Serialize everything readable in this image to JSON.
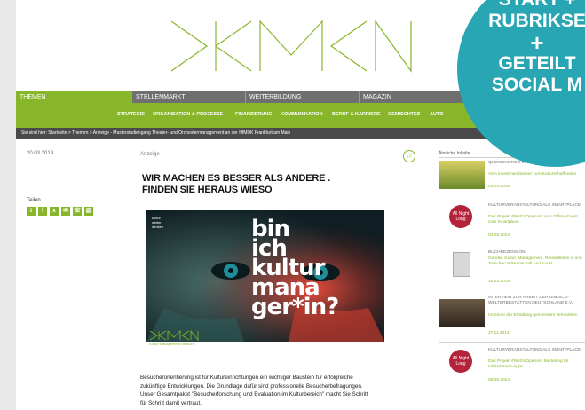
{
  "main_nav": [
    {
      "label": "THEMEN",
      "active": true
    },
    {
      "label": "STELLENMARKT",
      "active": false
    },
    {
      "label": "WEITERBILDUNG",
      "active": false
    },
    {
      "label": "MAGAZIN",
      "active": false
    }
  ],
  "sub_nav": [
    "STRATEGIE",
    "ORGANISATION & PROZESSE",
    "FINANZIERUNG",
    "KOMMUNIKATION",
    "BERUF & KARRIERE",
    "GEMISCHTES",
    "AUTO"
  ],
  "breadcrumb": "Sie sind hier: Startseite > Themen > Anzeige - Masterstudiengang Theater- und Orchestermanagement an der HfMDK Frankfurt am Main",
  "article": {
    "date": "20.03.2019",
    "kicker": "Anzeige",
    "headline_1": "WIR MACHEN ES BESSER ALS ANDERE .",
    "headline_2": "FINDEN SIE HERAUS WIESO",
    "hero_tag": "kultur\nweiter\ndenken",
    "hero_words": [
      "bin",
      "ich",
      "kultur",
      "mana",
      "ger*in?"
    ],
    "kmn_caption": "Kultur Management Network",
    "body": [
      "Besucherorientierung ist für Kultureinrichtungen ein wichtiger Baustein für erfolgreiche",
      "zukünftige Entwicklungen. Die Grundlage dafür sind professionelle Besucherbefragungen.",
      "Unser Gesamtpaket \"Besucherforschung und Evaluation im Kulturbereich\" macht Sie Schritt",
      "für Schritt damit vertraut."
    ]
  },
  "share": {
    "label": "Teilen",
    "icons": [
      "twitter-icon",
      "facebook-icon",
      "xing-icon",
      "mail-icon",
      "whatsapp-icon",
      "print-icon"
    ]
  },
  "aside": {
    "title": "Ähnliche Inhalte",
    "items": [
      {
        "title": "QUEREINSTIEG IN DIE KULTUR",
        "desc": "Vom Investmentbanker zum Kulturschaffenden",
        "date": "03.04.2019",
        "thumb": "landscape"
      },
      {
        "title": "KULTURVERANSTALTUNG ALS SMARTPLACE",
        "desc": "Das Projekt #WirGoOpenAir: vom Offline-Event zum Smartplace",
        "date": "04.09.2014",
        "thumb": "all-night-long"
      },
      {
        "title": "BUCHREZENSION",
        "desc": "Gender, Kultur, Management. Reisediktess in und zwischen Wissenschaft und Kunst",
        "date": "15.03.2019",
        "thumb": "book"
      },
      {
        "title": "INTERVIEW ZUR ARBEIT DER UNESCO-WELTERBESTÄTTEN DEUTSCHLAND E.V.",
        "desc": "Im Sinne der Erhaltung gemeinsam vermarkten",
        "date": "27.11.2014",
        "thumb": "unesco"
      },
      {
        "title": "KULTURVERANSTALTUNG ALS SMARTPLACE",
        "desc": "Das Projekt #WirGoOpenAir: Marketing für Infotainment-Apps",
        "date": "06.09.2014",
        "thumb": "all-night-long"
      }
    ]
  },
  "badge": {
    "line1": "START +",
    "line2": "RUBRIKSE",
    "line3": "+",
    "line4": "GETEILT",
    "line5": "SOCIAL M"
  },
  "colors": {
    "accent": "#87b62a",
    "nav": "#6f6f6f",
    "badge": "#29a6b3"
  }
}
